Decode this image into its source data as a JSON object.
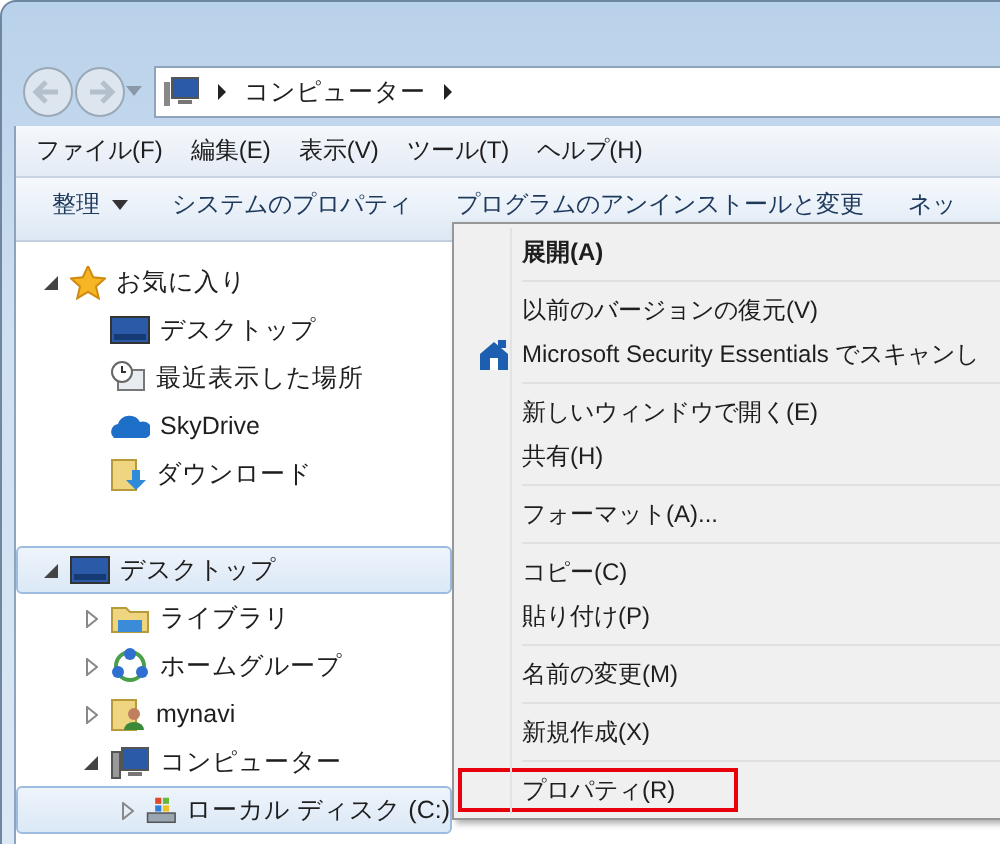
{
  "address": {
    "crumbs": [
      "コンピューター"
    ]
  },
  "menu_bar": [
    "ファイル(F)",
    "編集(E)",
    "表示(V)",
    "ツール(T)",
    "ヘルプ(H)"
  ],
  "command_bar": [
    {
      "label": "整理",
      "dropdown": true
    },
    {
      "label": "システムのプロパティ",
      "dropdown": false
    },
    {
      "label": "プログラムのアンインストールと変更",
      "dropdown": false
    },
    {
      "label": "ネッ",
      "dropdown": false
    }
  ],
  "nav_groups": [
    [
      {
        "label": "お気に入り",
        "kind": "star",
        "expanded": true,
        "selected": false,
        "children": [
          {
            "label": "デスクトップ",
            "kind": "desktop",
            "selected": false
          },
          {
            "label": "最近表示した場所",
            "kind": "recent",
            "selected": false
          },
          {
            "label": "SkyDrive",
            "kind": "cloud",
            "selected": false
          },
          {
            "label": "ダウンロード",
            "kind": "download",
            "selected": false
          }
        ]
      }
    ],
    [
      {
        "label": "デスクトップ",
        "kind": "desktop",
        "expanded": true,
        "selected": true,
        "children": [
          {
            "label": "ライブラリ",
            "kind": "library",
            "expanded": false,
            "selected": false
          },
          {
            "label": "ホームグループ",
            "kind": "homegroup",
            "expanded": false,
            "selected": false
          },
          {
            "label": "mynavi",
            "kind": "user",
            "expanded": false,
            "selected": false
          },
          {
            "label": "コンピューター",
            "kind": "computer",
            "expanded": true,
            "selected": false,
            "children": [
              {
                "label": "ローカル ディスク (C:)",
                "kind": "disk",
                "expanded": false,
                "selected": true
              }
            ]
          }
        ]
      }
    ]
  ],
  "context_menu": [
    [
      {
        "label": "展開(A)",
        "bold": true,
        "icon": false,
        "highlighted": false
      }
    ],
    [
      {
        "label": "以前のバージョンの復元(V)",
        "bold": false,
        "icon": false,
        "highlighted": false
      },
      {
        "label": "Microsoft Security Essentials でスキャンし",
        "bold": false,
        "icon": true,
        "highlighted": false
      }
    ],
    [
      {
        "label": "新しいウィンドウで開く(E)",
        "bold": false,
        "icon": false,
        "highlighted": false
      },
      {
        "label": "共有(H)",
        "bold": false,
        "icon": false,
        "highlighted": false
      }
    ],
    [
      {
        "label": "フォーマット(A)...",
        "bold": false,
        "icon": false,
        "highlighted": false
      }
    ],
    [
      {
        "label": "コピー(C)",
        "bold": false,
        "icon": false,
        "highlighted": false
      },
      {
        "label": "貼り付け(P)",
        "bold": false,
        "icon": false,
        "highlighted": false
      }
    ],
    [
      {
        "label": "名前の変更(M)",
        "bold": false,
        "icon": false,
        "highlighted": false
      }
    ],
    [
      {
        "label": "新規作成(X)",
        "bold": false,
        "icon": false,
        "highlighted": false
      }
    ],
    [
      {
        "label": "プロパティ(R)",
        "bold": false,
        "icon": false,
        "highlighted": true
      }
    ]
  ]
}
